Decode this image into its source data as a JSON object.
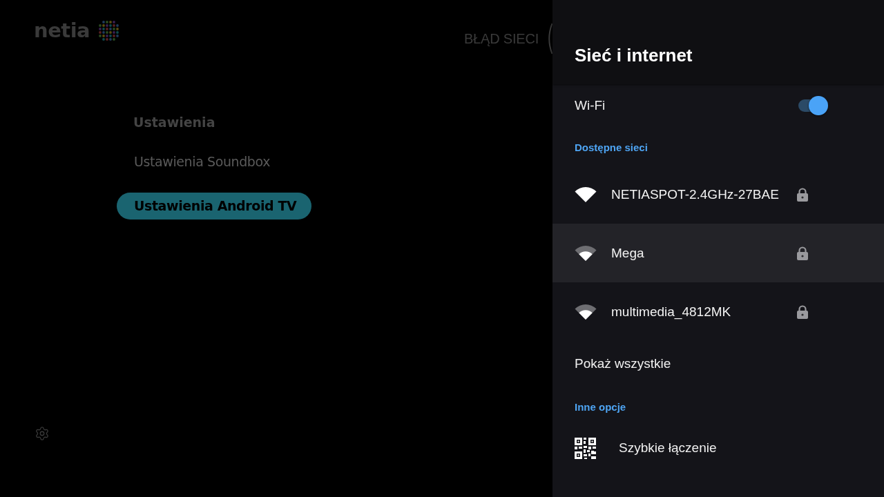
{
  "background": {
    "logo": "netia",
    "status": "BŁĄD SIECI",
    "menu_title": "Ustawienia",
    "menu": [
      {
        "label": "Ustawienia Soundbox",
        "selected": false
      },
      {
        "label": "Ustawienia Android TV",
        "selected": true
      }
    ]
  },
  "panel": {
    "title": "Sieć i internet",
    "wifi": {
      "label": "Wi-Fi",
      "on": true
    },
    "available_header": "Dostępne sieci",
    "networks": [
      {
        "name": "NETIASPOT-2.4GHz-27BAE",
        "kind": "strong",
        "locked": true,
        "selected": false
      },
      {
        "name": "Mega",
        "kind": "medium",
        "locked": true,
        "selected": true
      },
      {
        "name": "multimedia_4812MK",
        "kind": "medium",
        "locked": true,
        "selected": false
      }
    ],
    "show_all": "Pokaż wszystkie",
    "other_header": "Inne opcje",
    "other_options": [
      {
        "label": "Szybkie łączenie",
        "kind": "qr"
      }
    ]
  }
}
